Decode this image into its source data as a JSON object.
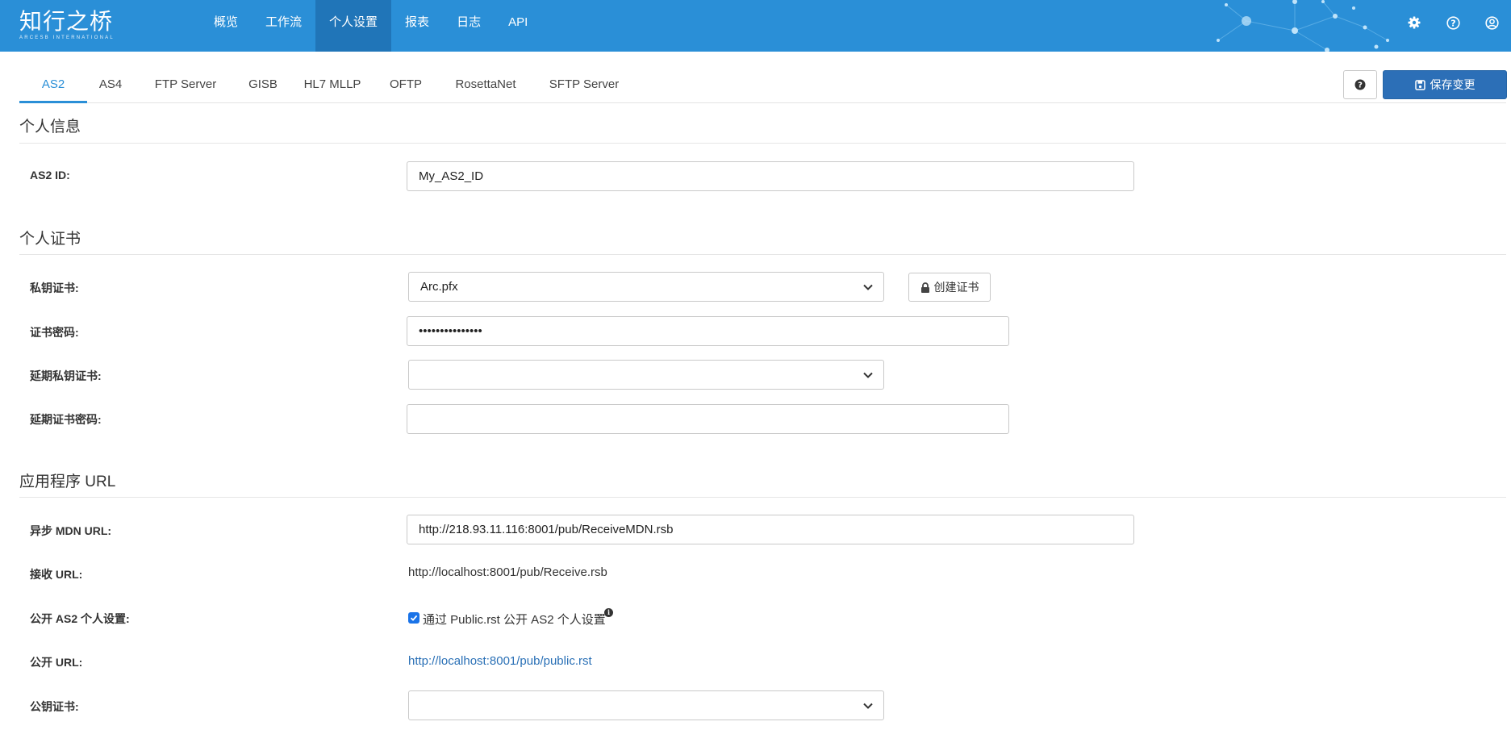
{
  "brand": {
    "name": "知行之桥",
    "subtitle": "ARCESB INTERNATIONAL"
  },
  "nav": {
    "items": [
      "概览",
      "工作流",
      "个人设置",
      "报表",
      "日志",
      "API"
    ],
    "active": "个人设置"
  },
  "top_icons": [
    "gear-icon",
    "question-circle-icon",
    "user-circle-icon"
  ],
  "tabs": [
    "AS2",
    "AS4",
    "FTP Server",
    "GISB",
    "HL7 MLLP",
    "OFTP",
    "RosettaNet",
    "SFTP Server"
  ],
  "active_tab": "AS2",
  "toolbar": {
    "save_label": "保存变更",
    "help_icon": "question-circle-icon"
  },
  "sections": {
    "personal_info": {
      "title": "个人信息",
      "as2_id_label": "AS2 ID:",
      "as2_id_value": "My_AS2_ID"
    },
    "personal_cert": {
      "title": "个人证书",
      "private_cert_label": "私钥证书:",
      "private_cert_value": "Arc.pfx",
      "create_cert_label": "创建证书",
      "cert_password_label": "证书密码:",
      "cert_password_value": "•••••••••••••••",
      "deferred_cert_label": "延期私钥证书:",
      "deferred_cert_value": "",
      "deferred_password_label": "延期证书密码:",
      "deferred_password_value": ""
    },
    "app_url": {
      "title": "应用程序 URL",
      "async_mdn_label": "异步 MDN URL:",
      "async_mdn_value": "http://218.93.11.116:8001/pub/ReceiveMDN.rsb",
      "receive_url_label": "接收 URL:",
      "receive_url_value": "http://localhost:8001/pub/Receive.rsb",
      "public_profile_label": "公开 AS2 个人设置:",
      "public_profile_checkbox_label": "通过 Public.rst 公开 AS2 个人设置",
      "public_profile_checked": true,
      "public_url_label": "公开 URL:",
      "public_url_value": "http://localhost:8001/pub/public.rst",
      "public_cert_label": "公钥证书:",
      "public_cert_value": ""
    }
  },
  "colors": {
    "header": "#2a8fd7",
    "nav_active": "#2075b8",
    "accent": "#2a8fd7",
    "save_button": "#2c6fb7",
    "link": "#2a70b6",
    "checkbox": "#1a73e8"
  }
}
